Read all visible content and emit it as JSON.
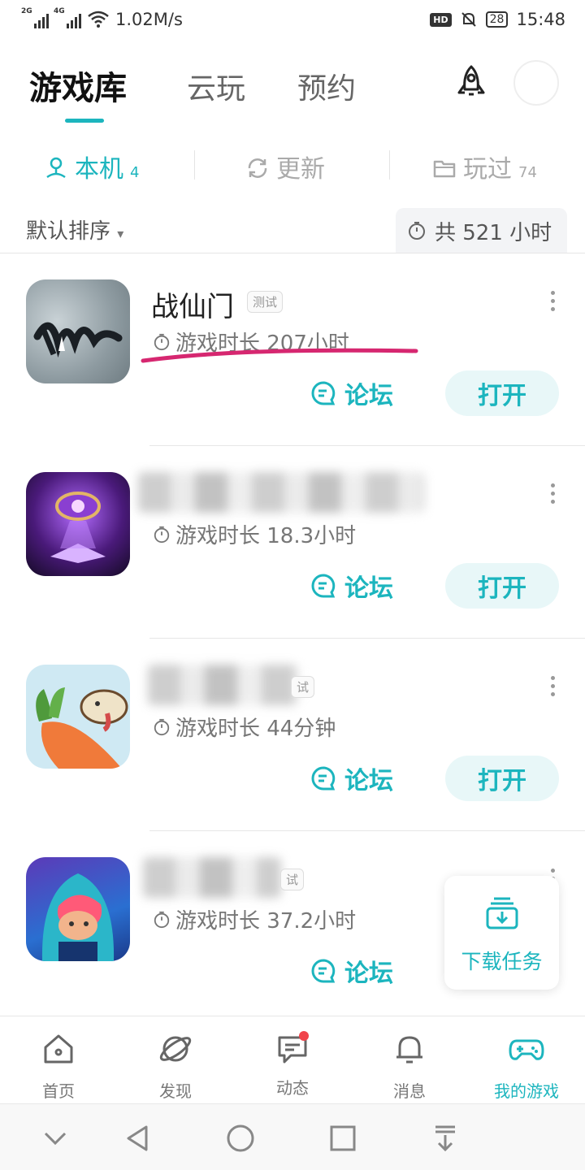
{
  "status_bar": {
    "network1": "2G",
    "network2": "4G",
    "speed": "1.02M/s",
    "hd": "HD",
    "battery": "28",
    "time": "15:48"
  },
  "header": {
    "tabs": [
      {
        "label": "游戏库",
        "active": true
      },
      {
        "label": "云玩",
        "active": false
      },
      {
        "label": "预约",
        "active": false
      }
    ]
  },
  "subtabs": [
    {
      "label": "本机",
      "count": "4",
      "icon": "person-platform-icon",
      "active": true
    },
    {
      "label": "更新",
      "count": "",
      "icon": "refresh-icon",
      "active": false
    },
    {
      "label": "玩过",
      "count": "74",
      "icon": "folder-icon",
      "active": false
    }
  ],
  "sort": {
    "label": "默认排序"
  },
  "total_time": "共 521 小时",
  "games": [
    {
      "name": "战仙门",
      "tag": "测试",
      "playtime": "游戏时长 207小时",
      "forum": "论坛",
      "open": "打开",
      "blurred": false
    },
    {
      "name": "",
      "tag": "",
      "playtime": "游戏时长 18.3小时",
      "forum": "论坛",
      "open": "打开",
      "blurred": true
    },
    {
      "name": "",
      "tag": "试",
      "playtime": "游戏时长 44分钟",
      "forum": "论坛",
      "open": "打开",
      "blurred": true
    },
    {
      "name": "",
      "tag": "试",
      "playtime": "游戏时长 37.2小时",
      "forum": "论坛",
      "open": "",
      "blurred": true
    }
  ],
  "download_card": {
    "label": "下载任务"
  },
  "bottom_nav": [
    {
      "label": "首页",
      "icon": "home-icon",
      "active": false
    },
    {
      "label": "发现",
      "icon": "planet-icon",
      "active": false
    },
    {
      "label": "动态",
      "icon": "chat-icon",
      "active": false,
      "badge": true
    },
    {
      "label": "消息",
      "icon": "bell-icon",
      "active": false
    },
    {
      "label": "我的游戏",
      "icon": "gamepad-icon",
      "active": true
    }
  ],
  "colors": {
    "accent": "#1cb5be",
    "accent_light": "#e8f7f8",
    "highlight": "#d62770",
    "badge": "#f0444b"
  }
}
